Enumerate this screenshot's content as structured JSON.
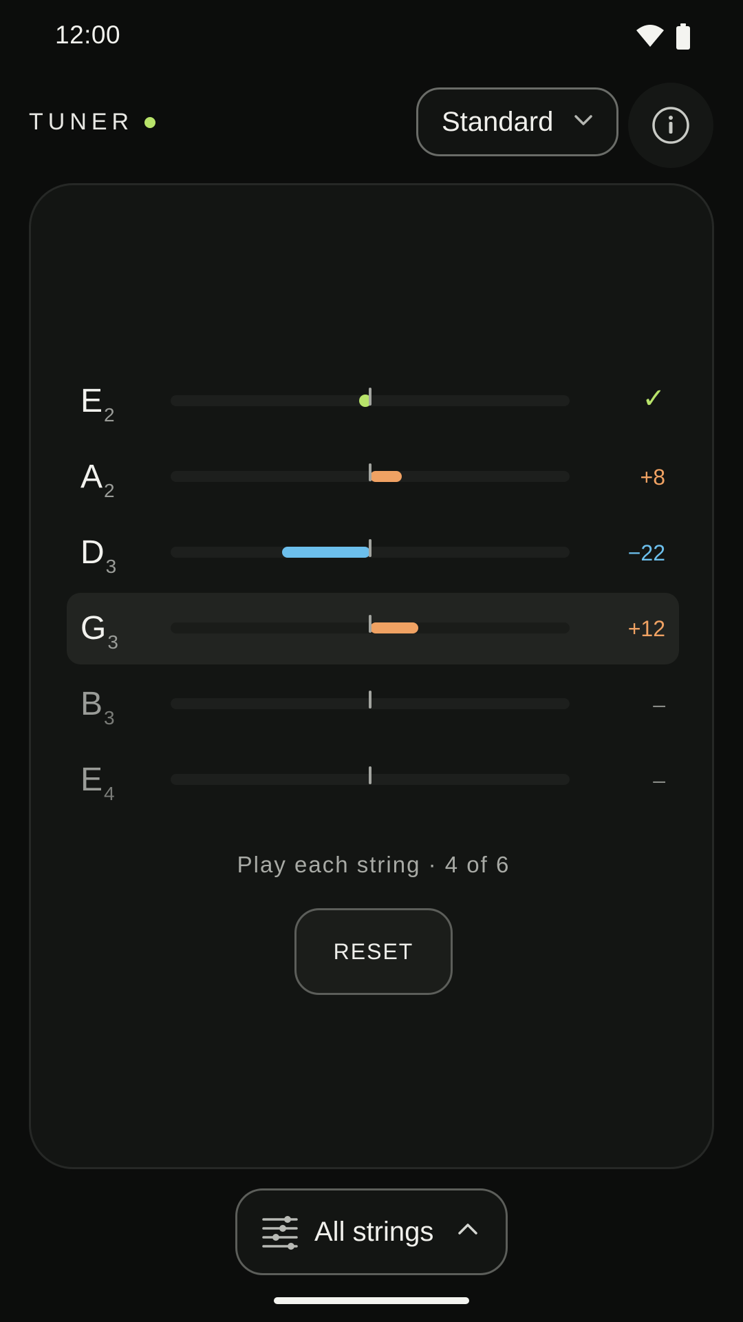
{
  "status_bar": {
    "time": "12:00",
    "icons": [
      "wifi-icon",
      "battery-icon"
    ]
  },
  "header": {
    "title": "TUNER",
    "live_indicator_color": "#b8e36a",
    "tuning": "Standard",
    "info_icon": "info-icon"
  },
  "colors": {
    "in_tune": "#b8e36a",
    "sharp": "#f0a263",
    "flat": "#6cbfec",
    "inactive": "#8a8c88"
  },
  "strings": [
    {
      "note": "E",
      "octave": "2",
      "cents": 0,
      "readout": "✓",
      "state": "in-tune"
    },
    {
      "note": "A",
      "octave": "2",
      "cents": 8,
      "readout": "+8",
      "state": "sharp"
    },
    {
      "note": "D",
      "octave": "3",
      "cents": -22,
      "readout": "−22",
      "state": "flat"
    },
    {
      "note": "G",
      "octave": "3",
      "cents": 12,
      "readout": "+12",
      "state": "sharp",
      "active": true
    },
    {
      "note": "B",
      "octave": "3",
      "cents": null,
      "readout": "–",
      "state": "pending"
    },
    {
      "note": "E",
      "octave": "4",
      "cents": null,
      "readout": "–",
      "state": "pending"
    }
  ],
  "progress": {
    "text": "Play each string · 4 of 6",
    "current": 4,
    "total": 6
  },
  "reset_label": "RESET",
  "string_filter": {
    "label": "All strings",
    "icon": "sliders-icon"
  }
}
